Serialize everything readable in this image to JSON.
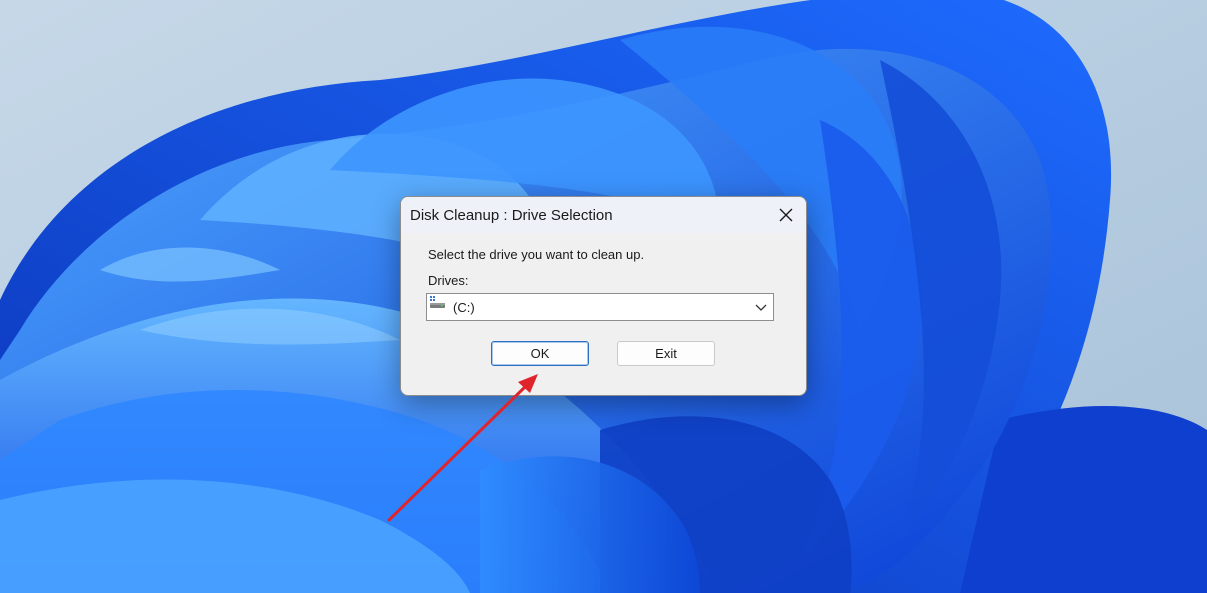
{
  "dialog": {
    "title": "Disk Cleanup : Drive Selection",
    "instruction": "Select the drive you want to clean up.",
    "drives_label": "Drives:",
    "selected_drive": "(C:)",
    "ok_label": "OK",
    "exit_label": "Exit"
  },
  "icons": {
    "close": "close-icon",
    "drive": "hard-drive-icon",
    "dropdown": "chevron-down-icon"
  },
  "colors": {
    "annotation_arrow": "#e0242c",
    "ok_border": "#2a6fc0"
  }
}
